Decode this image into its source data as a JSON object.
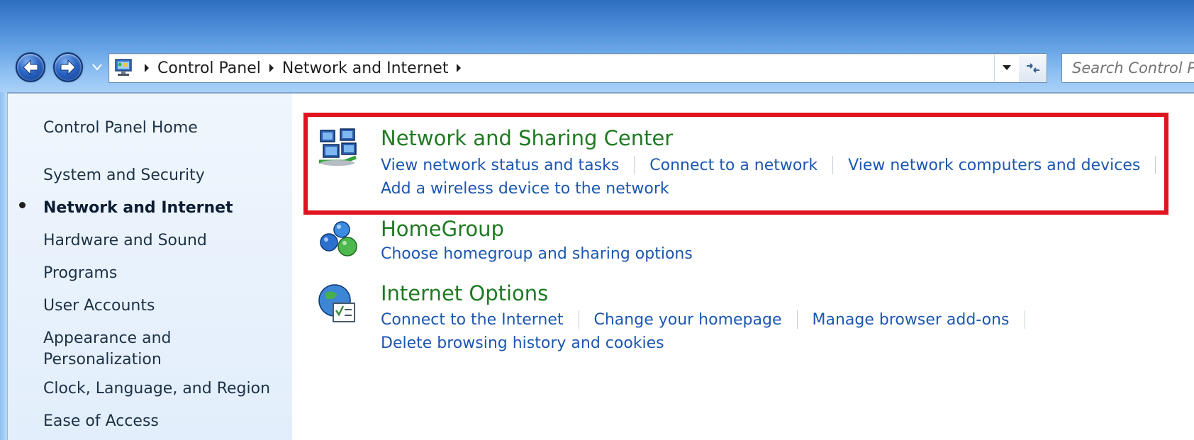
{
  "address": {
    "crumbs": [
      "Control Panel",
      "Network and Internet"
    ],
    "search_placeholder": "Search Control P"
  },
  "sidebar": {
    "home": "Control Panel Home",
    "items": [
      {
        "label": "System and Security",
        "active": false
      },
      {
        "label": "Network and Internet",
        "active": true
      },
      {
        "label": "Hardware and Sound",
        "active": false
      },
      {
        "label": "Programs",
        "active": false
      },
      {
        "label": "User Accounts",
        "active": false
      },
      {
        "label": "Appearance and",
        "label2": "Personalization",
        "active": false
      },
      {
        "label": "Clock, Language, and Region",
        "active": false
      },
      {
        "label": "Ease of Access",
        "active": false
      }
    ]
  },
  "categories": [
    {
      "title": "Network and Sharing Center",
      "icon": "network-sharing-icon",
      "links": [
        "View network status and tasks",
        "Connect to a network",
        "View network computers and devices"
      ],
      "links2": [
        "Add a wireless device to the network"
      ]
    },
    {
      "title": "HomeGroup",
      "icon": "homegroup-icon",
      "links": [
        "Choose homegroup and sharing options"
      ]
    },
    {
      "title": "Internet Options",
      "icon": "internet-options-icon",
      "links": [
        "Connect to the Internet",
        "Change your homepage",
        "Manage browser add-ons"
      ],
      "links2": [
        "Delete browsing history and cookies"
      ]
    }
  ],
  "colors": {
    "highlight": "#e0131e",
    "title_green": "#1f7a21",
    "link_blue": "#1c57b0"
  }
}
